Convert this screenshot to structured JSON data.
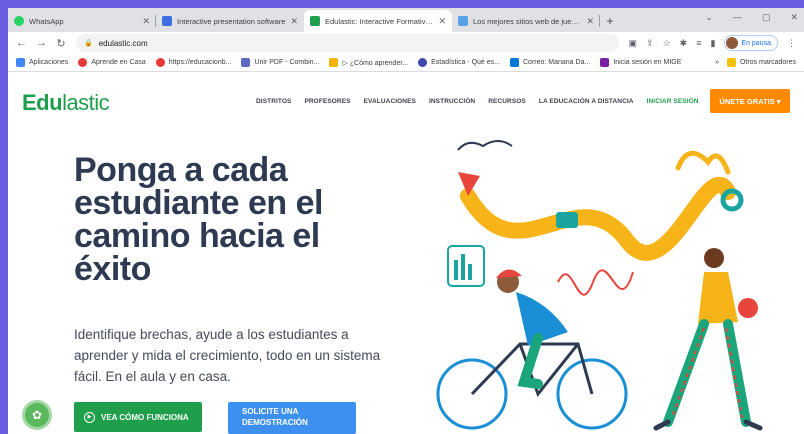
{
  "browser": {
    "tabs": [
      {
        "title": "WhatsApp",
        "color": "#25d366",
        "active": false
      },
      {
        "title": "Interactive presentation software",
        "color": "#3b6fe0",
        "active": false
      },
      {
        "title": "Edulastic: Interactive Formative A",
        "color": "#1f9f4c",
        "active": true
      },
      {
        "title": "Los mejores sitios web de juegos",
        "color": "#5aa0e8",
        "active": false
      }
    ],
    "new_tab": "+",
    "url": "edulastic.com",
    "profile_label": "En pausa",
    "bookmarks": [
      {
        "label": "Aplicaciones",
        "color": "#4285f4"
      },
      {
        "label": "Aprende en Casa",
        "color": "#e53935"
      },
      {
        "label": "https://educacionb...",
        "color": "#e53935"
      },
      {
        "label": "Unir PDF - Combin...",
        "color": "#5c6bc0"
      },
      {
        "label": "▷ ¿Cómo aprender...",
        "color": "#f4b400"
      },
      {
        "label": "Estadística - Qué es...",
        "color": "#3949ab"
      },
      {
        "label": "Correo: Mariana Da...",
        "color": "#0078d4"
      },
      {
        "label": "Inicia sesión en MIGE",
        "color": "#7b1fa2"
      }
    ],
    "bookmarks_more": "»",
    "other_bookmarks": "Otros marcadores"
  },
  "site": {
    "logo_bold": "Edu",
    "logo_rest": "lastic",
    "nav": [
      "DISTRITOS",
      "PROFESORES",
      "EVALUACIONES",
      "INSTRUCCIÓN",
      "RECURSOS",
      "LA EDUCACIÓN A DISTANCIA"
    ],
    "login": "INICIAR SESIÓN",
    "signup": "ÚNETE GRATIS ▾",
    "headline": "Ponga a cada estudiante en el camino hacia el éxito",
    "subtext": "Identifique brechas, ayude a los estudiantes a aprender y mida el crecimiento, todo en un sistema fácil. En el aula y en casa.",
    "btn_how": "VEA CÓMO FUNCIONA",
    "btn_demo": "SOLICITE UNA DEMOSTRACIÓN"
  },
  "colors": {
    "brand_green": "#1f9f4c",
    "orange": "#ff8a00",
    "blue": "#3d8ff0",
    "frame": "#6a5fe0"
  }
}
